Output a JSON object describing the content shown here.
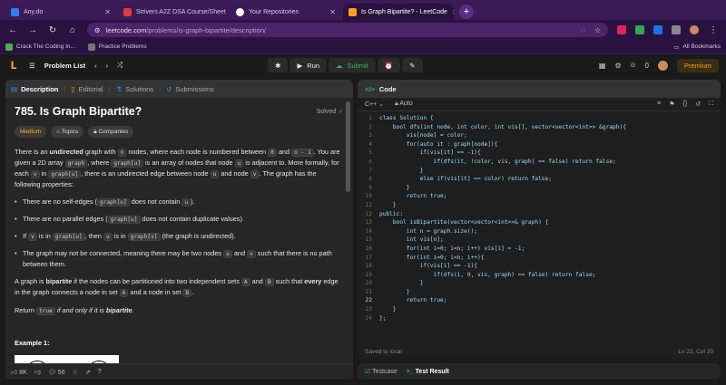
{
  "browser": {
    "tabs": [
      {
        "label": "Any.do",
        "icon_color": "#2d7ff9"
      },
      {
        "label": "Strivers A2Z DSA Course/Sheet",
        "icon_color": "#e03a3a"
      },
      {
        "label": "Your Repositories",
        "icon_color": "#ffffff"
      },
      {
        "label": "Is Graph Bipartite? - LeetCode",
        "icon_color": "#ffa116"
      }
    ],
    "url_host": "leetcode.com",
    "url_path": "/problems/is-graph-bipartite/description/",
    "bookmarks": [
      "Crack The Coding In...",
      "Practice Problems"
    ],
    "all_bookmarks": "All Bookmarks"
  },
  "toolbar": {
    "problem_list": "Problem List",
    "run": "Run",
    "submit": "Submit",
    "streak": "0",
    "premium": "Premium"
  },
  "left_panel": {
    "tabs": [
      "Description",
      "Editorial",
      "Solutions",
      "Submissions"
    ],
    "title": "785. Is Graph Bipartite?",
    "solved": "Solved",
    "difficulty": "Medium",
    "chips": [
      "Topics",
      "Companies"
    ],
    "p1a": "There is an ",
    "p1b": "undirected",
    "p1c": " graph with ",
    "p1d": " nodes, where each node is numbered between ",
    "p1e": " and ",
    "p1f": ". You are given a 2D array ",
    "p1g": ", where ",
    "p1h": " is an array of nodes that node ",
    "p1i": " is adjacent to. More formally, for each ",
    "p1j": " in ",
    "p1k": ", there is an undirected edge between node ",
    "p1l": " and node ",
    "p1m": ". The graph has the following properties:",
    "code_n": "n",
    "code_0": "0",
    "code_n1": "n - 1",
    "code_graph": "graph",
    "code_graphu": "graph[u]",
    "code_u": "u",
    "code_v": "v",
    "code_graphv": "graph[v]",
    "b1a": "There are no self-edges (",
    "b1b": " does not contain ",
    "b1c": ").",
    "b2a": "There are no parallel edges (",
    "b2b": " does not contain duplicate values).",
    "b3a": "If ",
    "b3b": " is in ",
    "b3c": ", then ",
    "b3d": " is in ",
    "b3e": " (the graph is undirected).",
    "b4a": "The graph may not be connected, meaning there may be two nodes ",
    "b4b": " and ",
    "b4c": " such that there is no path between them.",
    "p2a": "A graph is ",
    "p2b": "bipartite",
    "p2c": " if the nodes can be partitioned into two independent sets ",
    "p2d": " and ",
    "p2e": " such that ",
    "p2f": "every",
    "p2g": " edge in the graph connects a node in set ",
    "p2h": " and a node in set ",
    "p2i": ".",
    "code_A": "A",
    "code_B": "B",
    "code_true": "true",
    "p3a": "Return ",
    "p3b": " if and only if it is ",
    "p3c": "bipartite",
    "p3d": ".",
    "example_title": "Example 1:",
    "example_nodes": [
      "0",
      "1"
    ],
    "likes": "8K",
    "comments": "56"
  },
  "editor": {
    "title": "Code",
    "language": "C++",
    "mode": "Auto",
    "lines": [
      "class Solution {",
      "    bool dfs(int node, int color, int vis[], vector<vector<int>> &graph){",
      "        vis[node] = color;",
      "        for(auto it : graph[node]){",
      "            if(vis[it] == -1){",
      "                if(dfs(it, !color, vis, graph) == false) return false;",
      "            }",
      "            else if(vis[it] == color) return false;",
      "        }",
      "        return true;",
      "    }",
      "public:",
      "    bool isBipartite(vector<vector<int>>& graph) {",
      "        int n = graph.size();",
      "        int vis[n];",
      "        for(int i=0; i<n; i++) vis[i] = -1;",
      "        for(int i=0; i<n; i++){",
      "            if(vis[i] == -1){",
      "                if(dfs(i, 0, vis, graph) == false) return false;",
      "            }",
      "        }",
      "        return true;",
      "    }",
      "};"
    ],
    "status": "Saved to local",
    "cursor": "Ln 22, Col 20"
  },
  "results": {
    "testcase": "Testcase",
    "test_result": "Test Result"
  }
}
